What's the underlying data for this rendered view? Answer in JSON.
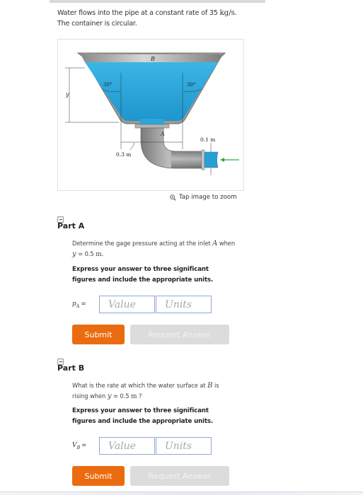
{
  "intro": {
    "line1_text": "Water flows into the pipe at a constant rate of 35",
    "line1_unit": "kg/s",
    "line1_end": ".",
    "line2": "The container is circular."
  },
  "figure": {
    "labels": {
      "B": "B",
      "A": "A",
      "y": "y",
      "angle_left": "30°",
      "angle_right": "30°",
      "width_bottom": "0.3 m",
      "pipe_diameter": "0.1 m"
    },
    "colors": {
      "water": "#2aa7d8",
      "container": "#9a9a9a",
      "flow_arrow": "#2fa84f"
    },
    "tap_to_zoom": "Tap image to zoom"
  },
  "parts": [
    {
      "heading": "Part A",
      "question_pre": "Determine the gage pressure acting at the inlet",
      "question_var": "A",
      "question_post": "when",
      "question_line2_var": "y",
      "question_line2_eq": "= 0.5",
      "question_line2_unit": "m",
      "question_line2_end": ".",
      "instruction_line1": "Express your answer to three significant",
      "instruction_line2": "figures and include the appropriate units.",
      "variable": "p",
      "variable_sub": "A",
      "equals": "=",
      "value_placeholder": "Value",
      "units_placeholder": "Units",
      "submit_label": "Submit",
      "request_label": "Request Answer"
    },
    {
      "heading": "Part B",
      "question_pre": "What is the rate at which the water surface at",
      "question_var": "B",
      "question_post": "is",
      "question_line2_pre": "rising when",
      "question_line2_var": "y",
      "question_line2_eq": "= 0.5",
      "question_line2_unit": "m",
      "question_line2_end": "?",
      "instruction_line1": "Express your answer to three significant",
      "instruction_line2": "figures and include the appropriate units.",
      "variable": "V",
      "variable_sub": "B",
      "equals": "=",
      "value_placeholder": "Value",
      "units_placeholder": "Units",
      "submit_label": "Submit",
      "request_label": "Request Answer"
    }
  ]
}
